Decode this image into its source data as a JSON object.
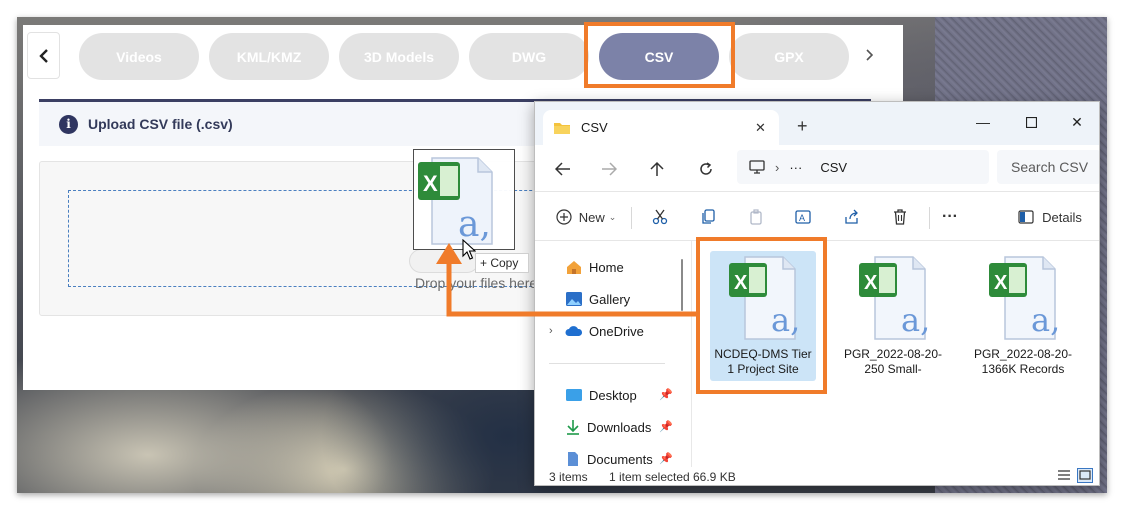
{
  "web": {
    "tabs": [
      "Videos",
      "KML/KMZ",
      "3D Models",
      "DWG",
      "CSV",
      "GPX"
    ],
    "active_tab": "CSV",
    "upload_title": "Upload CSV file (.csv)",
    "drop_text": "Drop your files here."
  },
  "drag": {
    "copy_label": "+ Copy"
  },
  "explorer": {
    "tab_title": "CSV",
    "address": {
      "more": "···",
      "folder": "CSV"
    },
    "search_placeholder": "Search CSV",
    "toolbar": {
      "new_label": "New",
      "more": "···",
      "details_label": "Details"
    },
    "nav_items": [
      {
        "label": "Home",
        "icon": "home-icon"
      },
      {
        "label": "Gallery",
        "icon": "gallery-icon"
      },
      {
        "label": "OneDrive",
        "icon": "cloud-icon"
      },
      {
        "label": "Desktop",
        "icon": "desktop-icon"
      },
      {
        "label": "Downloads",
        "icon": "download-icon"
      },
      {
        "label": "Documents",
        "icon": "documents-icon"
      }
    ],
    "files": [
      {
        "name_line1": "NCDEQ-DMS Tier",
        "name_line2": "1 Project Site",
        "selected": true
      },
      {
        "name_line1": "PGR_2022-08-20-",
        "name_line2": "250 Small-",
        "selected": false
      },
      {
        "name_line1": "PGR_2022-08-20-",
        "name_line2": "1366K Records",
        "selected": false
      }
    ],
    "status": {
      "items": "3 items",
      "selected": "1 item selected",
      "size": "66.9 KB"
    }
  },
  "colors": {
    "highlight": "#f07b2a",
    "active_tab": "#7c82a8",
    "selection": "#cce4f7"
  }
}
